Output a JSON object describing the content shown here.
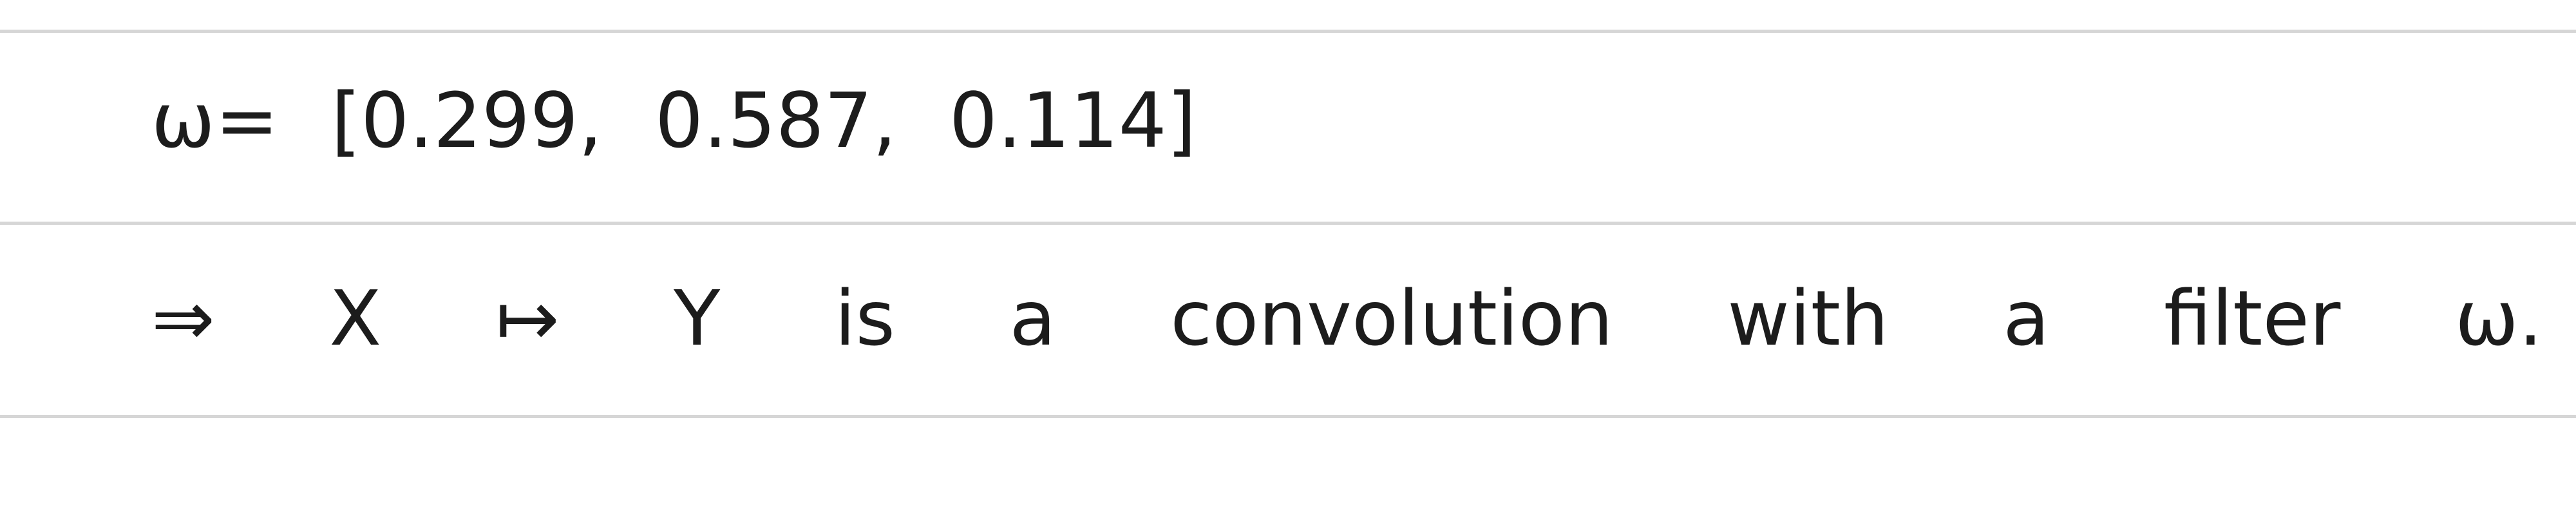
{
  "notebook": {
    "line1": "ω= [0.299, 0.587, 0.114]",
    "line2": "⇒ X ↦ Y is a convolution with a filter ω."
  }
}
